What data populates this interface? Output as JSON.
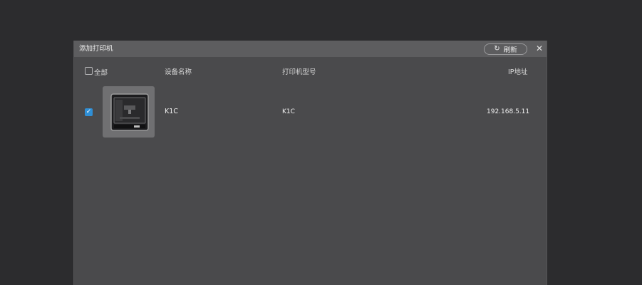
{
  "dialog": {
    "title": "添加打印机",
    "refresh_label": "刷新",
    "close_label": "✕"
  },
  "table": {
    "select_all_label": "全部",
    "select_all_checked": false,
    "columns": {
      "device_name": "设备名称",
      "printer_model": "打印机型号",
      "ip_address": "IP地址"
    },
    "rows": [
      {
        "checked": true,
        "device_name": "K1C",
        "printer_model": "K1C",
        "ip_address": "192.168.5.11"
      }
    ]
  },
  "colors": {
    "background": "#2c2c2e",
    "dialog": "#4a4a4c",
    "titlebar": "#5d5d5f",
    "accent": "#2f8fd6"
  },
  "icons": {
    "refresh": "refresh-icon",
    "close": "close-icon",
    "check": "check-icon",
    "printer": "3d-printer-icon"
  }
}
